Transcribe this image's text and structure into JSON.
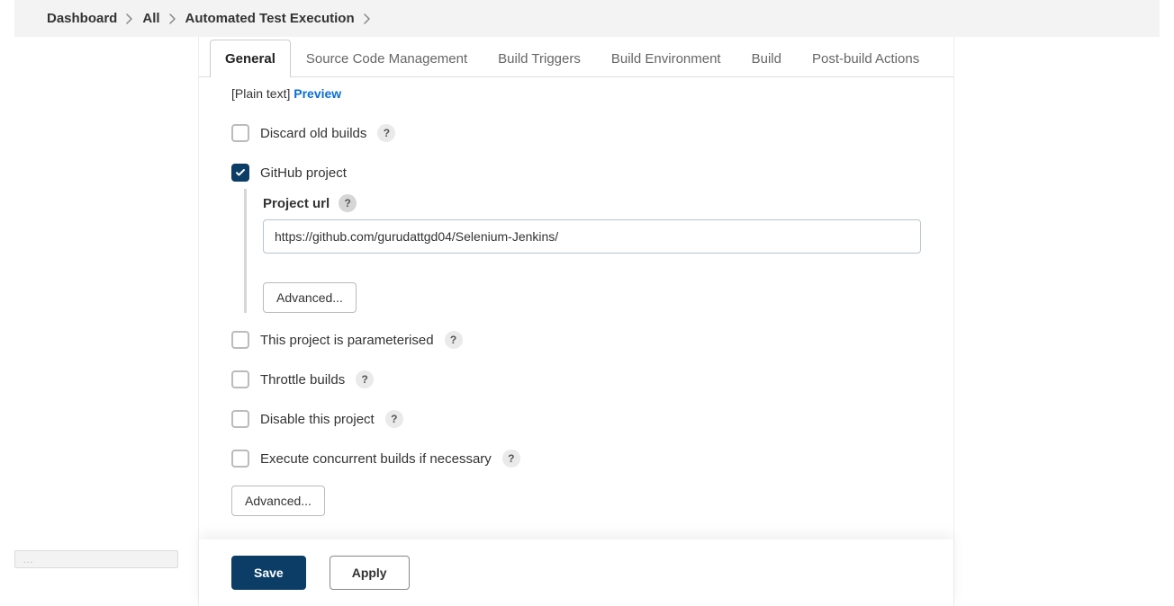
{
  "breadcrumb": {
    "items": [
      "Dashboard",
      "All",
      "Automated Test Execution"
    ]
  },
  "tabs": [
    {
      "label": "General",
      "active": true
    },
    {
      "label": "Source Code Management",
      "active": false
    },
    {
      "label": "Build Triggers",
      "active": false
    },
    {
      "label": "Build Environment",
      "active": false
    },
    {
      "label": "Build",
      "active": false
    },
    {
      "label": "Post-build Actions",
      "active": false
    }
  ],
  "description_format": {
    "plain_text": "[Plain text]",
    "preview": "Preview"
  },
  "options": {
    "discard_old_builds": {
      "label": "Discard old builds",
      "checked": false
    },
    "github_project": {
      "label": "GitHub project",
      "checked": true,
      "project_url_label": "Project url",
      "project_url_value": "https://github.com/gurudattgd04/Selenium-Jenkins/",
      "advanced_label": "Advanced..."
    },
    "parameterised": {
      "label": "This project is parameterised",
      "checked": false
    },
    "throttle_builds": {
      "label": "Throttle builds",
      "checked": false
    },
    "disable_project": {
      "label": "Disable this project",
      "checked": false
    },
    "concurrent_builds": {
      "label": "Execute concurrent builds if necessary",
      "checked": false
    },
    "outer_advanced_label": "Advanced..."
  },
  "footer": {
    "save": "Save",
    "apply": "Apply"
  },
  "help_glyph": "?",
  "statusbar": "…"
}
